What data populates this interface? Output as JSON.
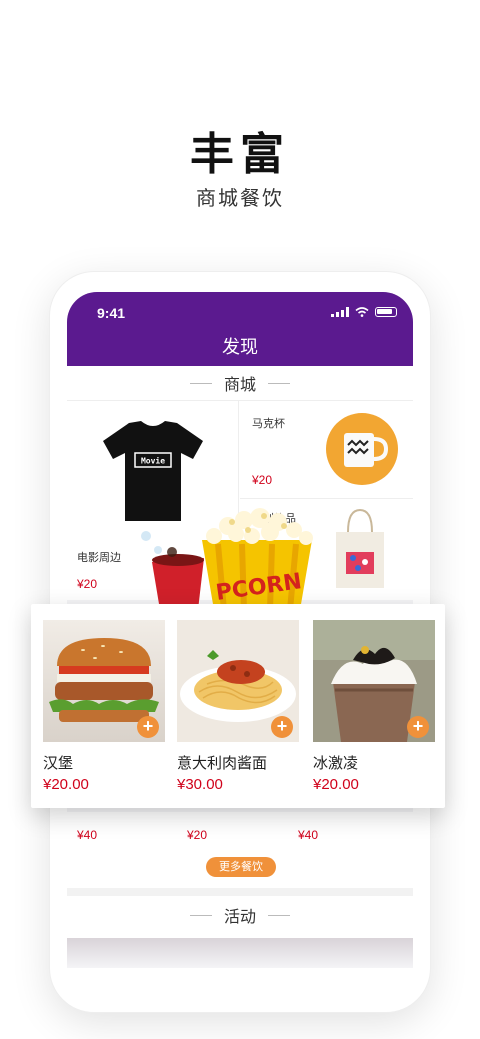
{
  "hero": {
    "title": "丰富",
    "subtitle": "商城餐饮"
  },
  "status_bar": {
    "time": "9:41"
  },
  "nav": {
    "title": "发现"
  },
  "shop": {
    "section_title": "商城",
    "items": [
      {
        "name": "电影周边",
        "price": "¥20",
        "icon": "tshirt-icon"
      },
      {
        "name": "马克杯",
        "price": "¥20",
        "icon": "mug-icon"
      },
      {
        "name": "文创礼品",
        "price": "",
        "icon": "tote-bag-icon"
      }
    ],
    "tshirt_text": "Movie"
  },
  "food": {
    "items": [
      {
        "name": "汉堡",
        "price": "¥20.00",
        "add_label": "+"
      },
      {
        "name": "意大利肉酱面",
        "price": "¥30.00",
        "add_label": "+"
      },
      {
        "name": "冰激凌",
        "price": "¥20.00",
        "add_label": "+"
      }
    ],
    "behind_prices": [
      "¥40",
      "¥20",
      "¥40"
    ],
    "more_label": "更多餐饮"
  },
  "activity": {
    "section_title": "活动"
  },
  "colors": {
    "brand_purple": "#5b1a8f",
    "accent_orange": "#f0913a",
    "price_red": "#d0021b"
  }
}
